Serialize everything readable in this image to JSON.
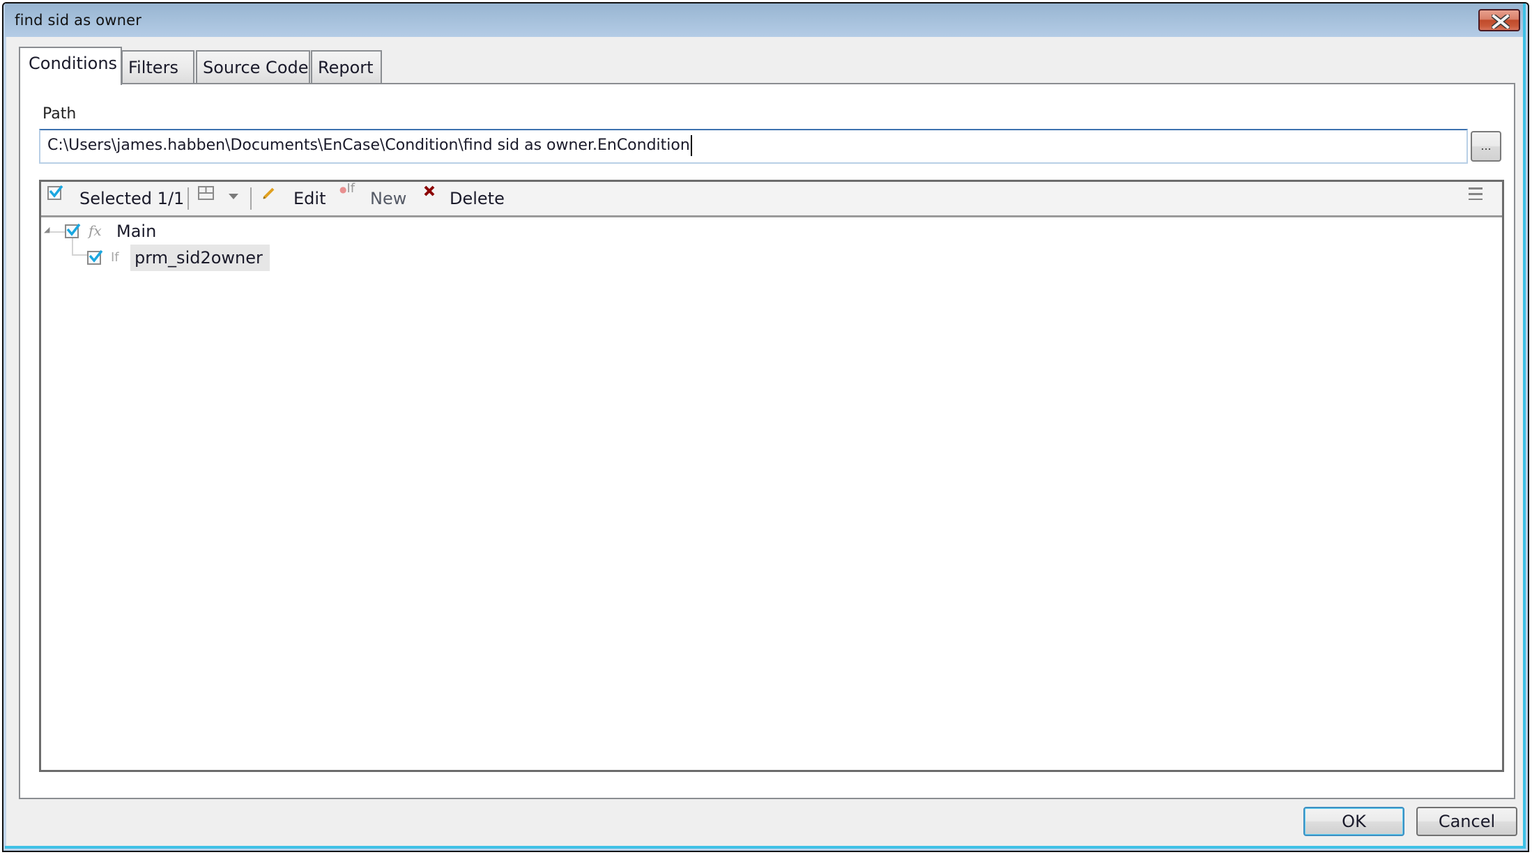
{
  "window": {
    "title": "find sid as owner",
    "close_icon": "close-icon"
  },
  "tabs": [
    {
      "label": "Conditions",
      "active": true
    },
    {
      "label": "Filters",
      "active": false
    },
    {
      "label": "Source Code",
      "active": false
    },
    {
      "label": "Report",
      "active": false
    }
  ],
  "path": {
    "label": "Path",
    "value": "C:\\Users\\james.habben\\Documents\\EnCase\\Condition\\find sid as owner.EnCondition",
    "browse_label": "..."
  },
  "toolbar": {
    "select_all_icon": "checkbox-icon",
    "selected_label": "Selected 1/1",
    "layout_icon": "layout-grid-icon",
    "dropdown_icon": "chevron-down-icon",
    "edit_icon": "pencil-icon",
    "edit_label": "Edit",
    "new_icon": "new-if-icon",
    "new_label": "New",
    "delete_icon": "delete-x-icon",
    "delete_label": "Delete",
    "menu_icon": "hamburger-menu-icon"
  },
  "tree": [
    {
      "label": "Main",
      "icon": "function-icon",
      "checked": true,
      "expanded": true,
      "level": 0
    },
    {
      "label": "prm_sid2owner",
      "icon": "if-icon",
      "checked": true,
      "level": 1,
      "selected": true
    }
  ],
  "buttons": {
    "ok": "OK",
    "cancel": "Cancel"
  },
  "colors": {
    "titlebar": "#b4cce6",
    "close_button": "#c04a2a",
    "frame_accent": "#3fc1e6",
    "delete_icon": "#8b0000",
    "edit_icon": "#e0a020",
    "checkbox_check": "#1aa7e0"
  }
}
